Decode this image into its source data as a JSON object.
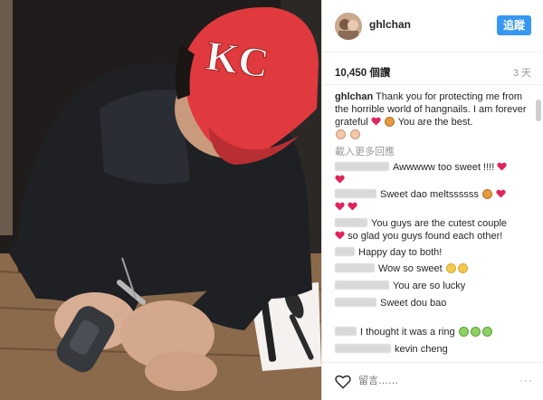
{
  "post": {
    "username": "ghlchan",
    "follow_label": "追蹤",
    "likes": "10,450 個讚",
    "age": "3 天"
  },
  "photo": {
    "cap_text": "KC",
    "cap_color": "#e03a3e"
  },
  "caption": {
    "username": "ghlchan",
    "text_1": "Thank you for protecting me from the horrible world of hangnails. I am forever grateful",
    "text_2": "You are the best."
  },
  "load_more": "載入更多回應",
  "comments": [
    {
      "text": "Awwwww too sweet !!!!"
    },
    {
      "text": "Sweet dao meltssssss"
    },
    {
      "text": "You guys are the cutest couple"
    },
    {
      "text": "so glad you guys found each other!"
    },
    {
      "text": "Happy day to both!"
    },
    {
      "text": "Wow so sweet"
    },
    {
      "text": "You are so lucky"
    },
    {
      "text": "Sweet dou bao"
    },
    {
      "text": "I thought it was a ring"
    },
    {
      "text": "kevin cheng"
    }
  ],
  "footer": {
    "comment_placeholder": "留言……",
    "more_label": "···"
  },
  "colors": {
    "accent": "#3897f0",
    "heart": "#ed4956"
  }
}
